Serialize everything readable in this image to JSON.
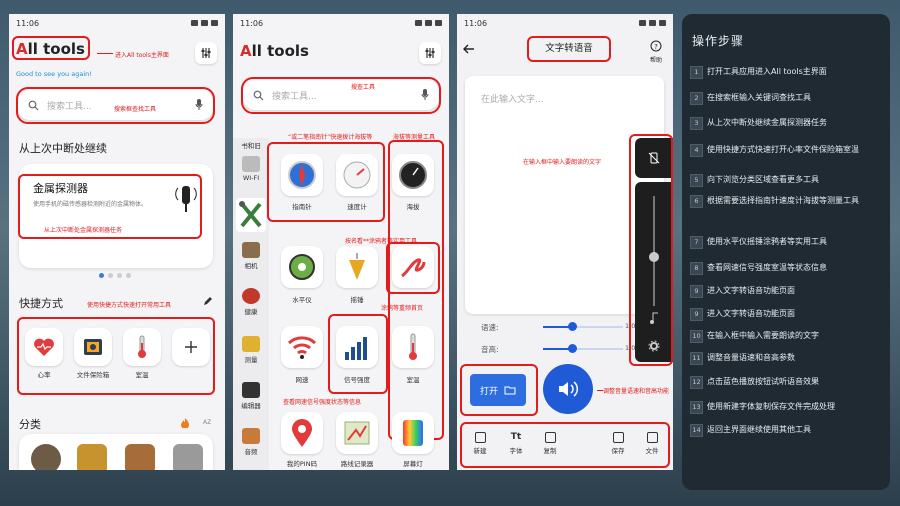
{
  "screens": {
    "p1": {
      "time": "11:06",
      "logo": "All tools",
      "logo_letter": "A",
      "logo_rest": "ll tools",
      "greeting": "Good to see you again!",
      "search_placeholder": "搜索工具...",
      "resume_title": "从上次中断处继续",
      "resume_card_title": "金属探测器",
      "resume_card_desc": "使用手机的磁传感器检测附近的金属物体。",
      "quick_title": "快捷方式",
      "quick_items": [
        "心率",
        "文件保险箱",
        "室温"
      ],
      "category_title": "分类",
      "annotations": {
        "main": "进入All tools主界面",
        "search": "搜索框查找工具",
        "resume": "从上次中断处金属探测器任务",
        "quick": "使用快捷方式快速打开常用工具"
      }
    },
    "p2": {
      "time": "11:06",
      "logo": "All tools",
      "logo_letter": "A",
      "logo_rest": "ll tools",
      "search_placeholder": "搜索工具...",
      "side_items": [
        "WI-FI",
        "相机",
        "健康",
        "测量",
        "编辑器",
        "音频"
      ],
      "side_top_partial": "书和旧",
      "tools": [
        "指南针",
        "速度计",
        "海拔",
        "水平仪",
        "摇锤",
        "",
        "网速",
        "信号强度",
        "室温",
        "我的PIN码",
        "路线记录器",
        "屏幕灯"
      ],
      "annotations": {
        "search": "搜查工具",
        "compass": "“或二笔指南针”快速拨计海拔等",
        "altitude": "海拔等测量工具",
        "level": "按名看**涂鸦者等实用工具",
        "misc": "涂鸦等重频首页",
        "signal": "查看网速信号强度状态等信息"
      }
    },
    "p3": {
      "time": "11:06",
      "title": "文字转语音",
      "help": "帮助",
      "input_placeholder": "在此输入文字...",
      "speed_label": "语速:",
      "pitch_label": "音高:",
      "speed_value": "1.0",
      "pitch_value": "1.0",
      "open_button": "打开",
      "bottom_tabs": [
        "新建",
        "字体",
        "复制",
        "保存",
        "文件"
      ],
      "annotations": {
        "input": "在输入框中输入要朗读的文字",
        "adjust": "调整音量语速和音高功能"
      }
    }
  },
  "panel": {
    "title": "操作步骤",
    "steps": [
      {
        "n": "1",
        "text": "打开工具应用进入All tools主界面"
      },
      {
        "n": "2",
        "text": "在搜索框输入关键词查找工具"
      },
      {
        "n": "3",
        "text": "从上次中断处继续金属探测器任务"
      },
      {
        "n": "4",
        "text": "使用快捷方式快速打开心率文件保险箱室温"
      },
      {
        "n": "5",
        "text": "向下浏览分类区域查看更多工具"
      },
      {
        "n": "6",
        "text": "根据需要选择指南针速度计海拔等测量工具"
      },
      {
        "n": "7",
        "text": "使用水平仪摇锤涂鸦者等实用工具"
      },
      {
        "n": "8",
        "text": "查看网速信号强度室温等状态信息"
      },
      {
        "n": "9",
        "text": "进入文字转语音功能页面"
      },
      {
        "n": "9",
        "text": "进入文字转语音功能页面"
      },
      {
        "n": "10",
        "text": "在输入框中输入需要朗读的文字"
      },
      {
        "n": "11",
        "text": "调整音量语速和音高参数"
      },
      {
        "n": "12",
        "text": "点击蓝色播放按钮试听语音效果"
      },
      {
        "n": "13",
        "text": "使用新建字体复制保存文件完成处理"
      },
      {
        "n": "14",
        "text": "返回主界面继续使用其他工具"
      }
    ]
  },
  "colors": {
    "accent_red": "#e21b1b",
    "play_blue": "#1f5bd6",
    "panel_bg": "#1f2a33"
  }
}
